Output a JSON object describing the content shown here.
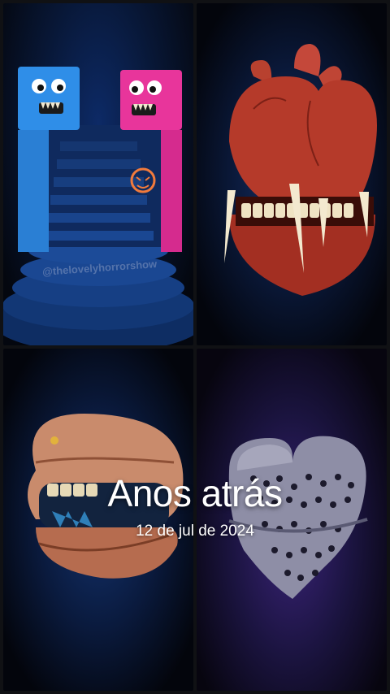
{
  "overlay": {
    "title": "Anos atrás",
    "date": "12 de jul de 2024"
  },
  "panels": {
    "top_left": {
      "watermark": "@thelovelyhorrorshow"
    }
  },
  "colors": {
    "background": "#101114",
    "blue_monster": "#2f8ee8",
    "pink_monster": "#e8359b",
    "heart": "#b53a2a",
    "lips": "#c98b6c",
    "perforated_heart": "#8e8ea6"
  }
}
